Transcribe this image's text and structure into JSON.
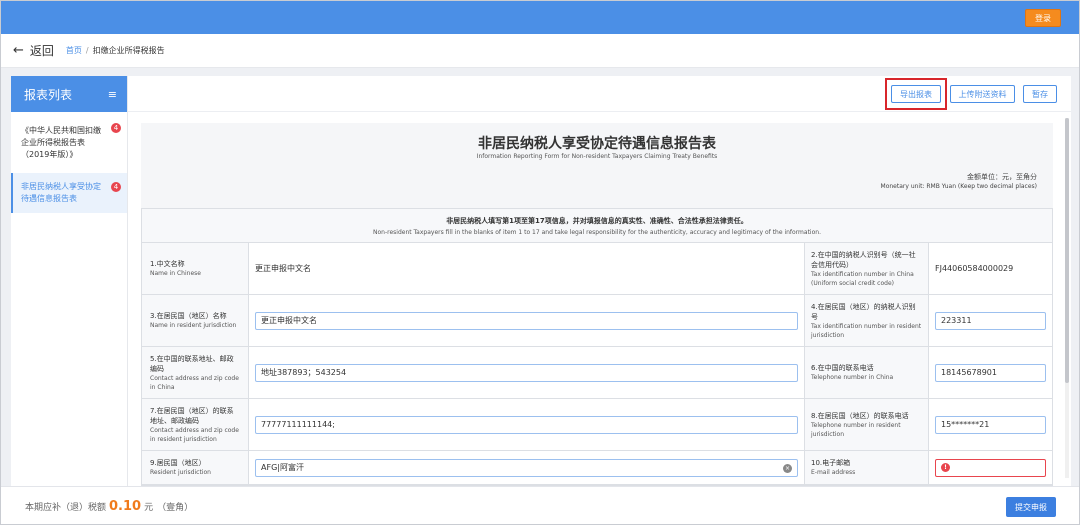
{
  "header": {
    "login_label": "登录"
  },
  "nav": {
    "back_icon": "←",
    "back_label": "返回",
    "breadcrumb_home": "首页",
    "breadcrumb_sep": "/",
    "breadcrumb_current": "扣缴企业所得税报告"
  },
  "sidebar": {
    "title": "报表列表",
    "menu_icon": "≡",
    "items": [
      {
        "label": "《中华人民共和国扣缴企业所得税报告表（2019年版）》",
        "badge": "4"
      },
      {
        "label": "非居民纳税人享受协定待遇信息报告表",
        "badge": "4"
      }
    ]
  },
  "toolbar": {
    "export_label": "导出报表",
    "upload_label": "上传附送资料",
    "save_label": "暂存"
  },
  "form": {
    "title_zh": "非居民纳税人享受协定待遇信息报告表",
    "title_en": "Information Reporting Form for Non-resident Taxpayers Claiming Treaty Benefits",
    "unit_zh": "金额单位：元，至角分",
    "unit_en": "Monetary unit: RMB Yuan (Keep two decimal places)",
    "notice_zh": "非居民纳税人填写第1项至第17项信息，并对填报信息的真实性、准确性、合法性承担法律责任。",
    "notice_en": "Non-resident Taxpayers fill in the blanks of item 1 to 17 and take legal responsibility for the authenticity, accuracy and legitimacy of the information.",
    "rows": [
      {
        "l1_zh": "1.中文名称",
        "l1_en": "Name in Chinese",
        "v1": "更正申报中文名",
        "l2_zh": "2.在中国的纳税人识别号（统一社会信用代码）",
        "l2_en": "Tax identification number in China (Uniform social credit code)",
        "v2": "FJ44060584000029"
      },
      {
        "l1_zh": "3.在居民国（地区）名称",
        "l1_en": "Name in resident jurisdiction",
        "v1": "更正申报中文名",
        "l2_zh": "4.在居民国（地区）的纳税人识别号",
        "l2_en": "Tax identification number in resident jurisdiction",
        "v2": "223311"
      },
      {
        "l1_zh": "5.在中国的联系地址、邮政编码",
        "l1_en": "Contact address and zip code in China",
        "v1": "地址387893；543254",
        "l2_zh": "6.在中国的联系电话",
        "l2_en": "Telephone number in China",
        "v2": "18145678901"
      },
      {
        "l1_zh": "7.在居民国（地区）的联系地址、邮政编码",
        "l1_en": "Contact address and zip code in resident jurisdiction",
        "v1": "77777111111144;",
        "l2_zh": "8.在居民国（地区）的联系电话",
        "l2_en": "Telephone number in resident jurisdiction",
        "v2": "15*******21"
      },
      {
        "l1_zh": "9.居民国（地区）",
        "l1_en": "Resident jurisdiction",
        "v1": "AFG|阿富汗",
        "l2_zh": "10.电子邮箱",
        "l2_en": "E-mail address",
        "v2": ""
      }
    ],
    "clear_icon": "×",
    "error_icon": "!"
  },
  "footer": {
    "label": "本期应补（退）税额",
    "amount": "0.10",
    "unit": "元",
    "amount_words": "（壹角）",
    "submit_label": "提交申报"
  }
}
